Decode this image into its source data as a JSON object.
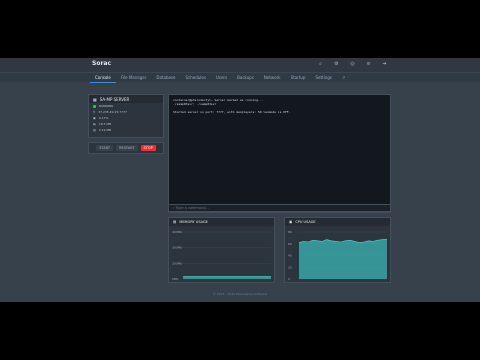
{
  "brand": "Sorac",
  "top_icons": [
    "search-icon",
    "gear-icon",
    "globe-icon",
    "settings-icon",
    "logout-icon"
  ],
  "nav": [
    "Console",
    "File Manager",
    "Database",
    "Schedules",
    "Users",
    "Backups",
    "Network",
    "Startup",
    "Settings"
  ],
  "server": {
    "title": "SA-MP SERVER",
    "status": "RUNNING",
    "rows": [
      "37.235.49.15:7777",
      "0.17%",
      "18.5 MB",
      "0.19 MB"
    ]
  },
  "controls": {
    "start": "START",
    "restart": "RESTART",
    "stop": "STOP"
  },
  "console": {
    "lines": [
      "container@pterodactyl~ Server marked as running...",
      "./samp03svr; ./samp03svr",
      "",
      "Started server on port: 7777, with maxplayers: 50 lanmode is OFF."
    ],
    "placeholder": "Type a command..."
  },
  "memory": {
    "title": "MEMORY USAGE",
    "ticks": [
      "400Mb",
      "300Mb",
      "200Mb",
      "0Mb"
    ]
  },
  "cpu": {
    "title": "CPU USAGE",
    "ticks": [
      "80",
      "60",
      "40",
      "20",
      "0"
    ]
  },
  "footer": "© 2015 - 2020 Pterodactyl Software",
  "colors": {
    "accent": "#3b8fd9",
    "stop": "#e0343a",
    "chart": "#3aa6a6"
  },
  "chart_data": [
    {
      "type": "area",
      "title": "MEMORY USAGE",
      "values": [
        20,
        20,
        20,
        20,
        20,
        20,
        20,
        20,
        20,
        20,
        20,
        20,
        20,
        20,
        20,
        20,
        20,
        20,
        20,
        20
      ],
      "ylim": [
        0,
        400
      ]
    },
    {
      "type": "area",
      "title": "CPU USAGE",
      "values": [
        62,
        64,
        63,
        66,
        65,
        64,
        67,
        65,
        64,
        63,
        65,
        66,
        64,
        62,
        63,
        65,
        64,
        66,
        67,
        68
      ],
      "ylim": [
        0,
        80
      ]
    }
  ]
}
